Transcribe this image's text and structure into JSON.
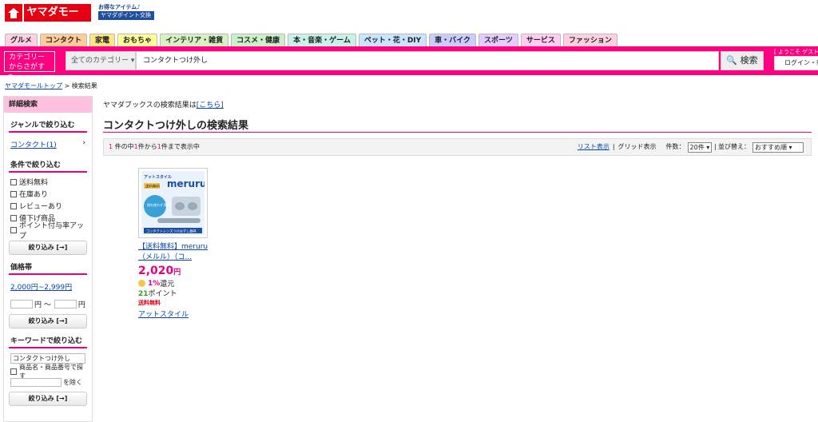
{
  "header": {
    "logo_text": "ヤマダモール",
    "promo_top": "お得なアイテム♪",
    "promo_bottom": "ヤマダポイント交換"
  },
  "tabs": [
    {
      "label": "グルメ",
      "color": "#ffd1e0"
    },
    {
      "label": "コンタクト",
      "color": "#ffcc99"
    },
    {
      "label": "家電",
      "color": "#ffe680"
    },
    {
      "label": "おもちゃ",
      "color": "#ffff99"
    },
    {
      "label": "インテリア・雑貨",
      "color": "#d7f2c2"
    },
    {
      "label": "コスメ・健康",
      "color": "#c9f0c8"
    },
    {
      "label": "本・音楽・ゲーム",
      "color": "#c6f2e8"
    },
    {
      "label": "ペット・花・DIY",
      "color": "#c8e4ff"
    },
    {
      "label": "車・バイク",
      "color": "#c9ccff"
    },
    {
      "label": "スポーツ",
      "color": "#e5ccff"
    },
    {
      "label": "サービス",
      "color": "#ffccf2"
    },
    {
      "label": "ファッション",
      "color": "#ffd1dc"
    }
  ],
  "search": {
    "category_button_line1": "カテゴリー",
    "category_button_line2": "からさがす ▾",
    "category_select": "全てのカテゴリー ▾",
    "query": "コンタクトつけ外し",
    "button_label": "🔍 検索"
  },
  "account": {
    "welcome": "[ ようこそ ゲスト様",
    "login": "ログイン・新"
  },
  "breadcrumb": {
    "home": "ヤマダモールトップ",
    "sep": " > ",
    "current": "検索結果"
  },
  "sidebar": {
    "header": "詳細検索",
    "genre_title": "ジャンルで絞り込む",
    "genre_link": "コンタクト(1)",
    "genre_arrow": "›",
    "conditions_title": "条件で絞り込む",
    "conditions": [
      "送料無料",
      "在庫あり",
      "レビューあり",
      "値下げ商品",
      "ポイント付与率アップ"
    ],
    "filter_button": "絞り込み [→]",
    "price_title": "価格帯",
    "price_link": "2,000円~2,999円",
    "price_from_unit": "円 〜",
    "price_to_unit": "円",
    "keyword_title": "キーワードで絞り込む",
    "keyword_value": "コンタクトつけ外し",
    "search_in_name": "商品名・商品番号で探す",
    "exclude_label": "を除く"
  },
  "main": {
    "books_text": "ヤマダブックスの検索結果は",
    "books_link": "[こちら]",
    "result_title": "コンタクトつけ外しの検索結果",
    "pager": {
      "total": "1",
      "total_suffix": " 件の中",
      "from": "1",
      "from_suffix": "件から",
      "to": "1",
      "to_suffix": "件まで表示中",
      "list_view": "リスト表示",
      "grid_view": "グリッド表示",
      "count_label": "件数：",
      "count_value": "20件 ▾",
      "sort_label": "並び替え：",
      "sort_value": "おすすめ順 ▾"
    }
  },
  "product": {
    "name_line1": "【送料無料】meruru",
    "name_line2": "（メルル）（コ...",
    "price": "2,020",
    "price_unit": "円",
    "rebate_rate": "1%",
    "rebate_suffix": "還元",
    "points": "21",
    "points_suffix": "ポイント",
    "shipping": "送料無料",
    "shop": "アットスタイル",
    "image_brand": "meruru",
    "image_maker": "アットスタイル",
    "image_badge": "送料無料",
    "image_bubble": "指を使わず 簡単・清潔",
    "image_caption": "コンタクトレンズつけはずし器具"
  }
}
